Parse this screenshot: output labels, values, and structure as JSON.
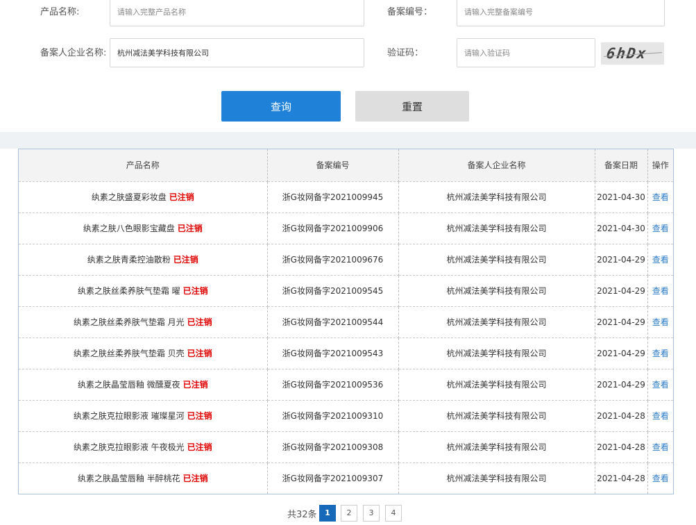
{
  "form": {
    "product_name_label": "产品名称:",
    "product_name_placeholder": "请输入完整产品名称",
    "product_name_value": "",
    "record_no_label": "备案编号：",
    "record_no_placeholder": "请输入完整备案编号",
    "record_no_value": "",
    "company_label": "备案人企业名称:",
    "company_placeholder": "",
    "company_value": "杭州减法美学科技有限公司",
    "captcha_label": "验证码：",
    "captcha_placeholder": "请输入验证码",
    "captcha_value": "",
    "captcha_text": "6hDx",
    "query_button": "查询",
    "reset_button": "重置"
  },
  "table": {
    "headers": [
      "产品名称",
      "备案编号",
      "备案人企业名称",
      "备案日期",
      "操作"
    ],
    "status_label": "已注销",
    "action_label": "查看",
    "rows": [
      {
        "name": "纨素之肤盛夏彩妆盘",
        "status": "已注销",
        "record_no": "浙G妆网备字2021009945",
        "company": "杭州减法美学科技有限公司",
        "date": "2021-04-30",
        "action": "查看"
      },
      {
        "name": "纨素之肤八色眼影宝藏盘",
        "status": "已注销",
        "record_no": "浙G妆网备字2021009906",
        "company": "杭州减法美学科技有限公司",
        "date": "2021-04-30",
        "action": "查看"
      },
      {
        "name": "纨素之肤青柔控油散粉",
        "status": "已注销",
        "record_no": "浙G妆网备字2021009676",
        "company": "杭州减法美学科技有限公司",
        "date": "2021-04-29",
        "action": "查看"
      },
      {
        "name": "纨素之肤丝柔养肤气垫霜 曜",
        "status": "已注销",
        "record_no": "浙G妆网备字2021009545",
        "company": "杭州减法美学科技有限公司",
        "date": "2021-04-29",
        "action": "查看"
      },
      {
        "name": "纨素之肤丝柔养肤气垫霜 月光",
        "status": "已注销",
        "record_no": "浙G妆网备字2021009544",
        "company": "杭州减法美学科技有限公司",
        "date": "2021-04-29",
        "action": "查看"
      },
      {
        "name": "纨素之肤丝柔养肤气垫霜 贝壳",
        "status": "已注销",
        "record_no": "浙G妆网备字2021009543",
        "company": "杭州减法美学科技有限公司",
        "date": "2021-04-29",
        "action": "查看"
      },
      {
        "name": "纨素之肤晶莹唇釉 微醺夏夜",
        "status": "已注销",
        "record_no": "浙G妆网备字2021009536",
        "company": "杭州减法美学科技有限公司",
        "date": "2021-04-29",
        "action": "查看"
      },
      {
        "name": "纨素之肤克拉眼影液 璀璨星河",
        "status": "已注销",
        "record_no": "浙G妆网备字2021009310",
        "company": "杭州减法美学科技有限公司",
        "date": "2021-04-28",
        "action": "查看"
      },
      {
        "name": "纨素之肤克拉眼影液 午夜极光",
        "status": "已注销",
        "record_no": "浙G妆网备字2021009308",
        "company": "杭州减法美学科技有限公司",
        "date": "2021-04-28",
        "action": "查看"
      },
      {
        "name": "纨素之肤晶莹唇釉 半醉桃花",
        "status": "已注销",
        "record_no": "浙G妆网备字2021009307",
        "company": "杭州减法美学科技有限公司",
        "date": "2021-04-28",
        "action": "查看"
      }
    ]
  },
  "pagination": {
    "total_text": "共32条",
    "pages": [
      "1",
      "2",
      "3",
      "4"
    ],
    "current_page": "1"
  },
  "colors": {
    "primary_button": "#1f82d8",
    "status_red": "#e00000",
    "link_blue": "#2b7bc9",
    "active_page": "#1669b8"
  }
}
